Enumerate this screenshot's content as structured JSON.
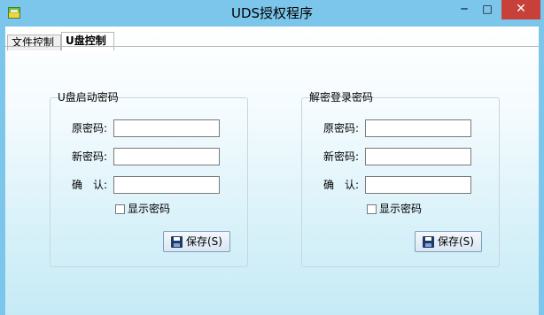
{
  "window": {
    "title": "UDS授权程序",
    "minimize_glyph": "─",
    "maximize_glyph": "□",
    "close_glyph": "✕"
  },
  "tabs": [
    {
      "label": "文件控制",
      "active": false
    },
    {
      "label": "U盘控制",
      "active": true
    }
  ],
  "groups": [
    {
      "title": "U盘启动密码",
      "old_label": "原密码:",
      "new_label": "新密码:",
      "confirm_label": "确　认:",
      "old_value": "",
      "new_value": "",
      "confirm_value": "",
      "show_password_label": "显示密码",
      "show_password_checked": false,
      "save_label": "保存(S)"
    },
    {
      "title": "解密登录密码",
      "old_label": "原密码:",
      "new_label": "新密码:",
      "confirm_label": "确　认:",
      "old_value": "",
      "new_value": "",
      "confirm_value": "",
      "show_password_label": "显示密码",
      "show_password_checked": false,
      "save_label": "保存(S)"
    }
  ],
  "icons": {
    "app": "app-icon",
    "save": "floppy-disk-icon"
  },
  "colors": {
    "titlebar": "#7cc6ec",
    "close_button": "#c7413a",
    "client_gradient_end": "#c6ebf6"
  }
}
